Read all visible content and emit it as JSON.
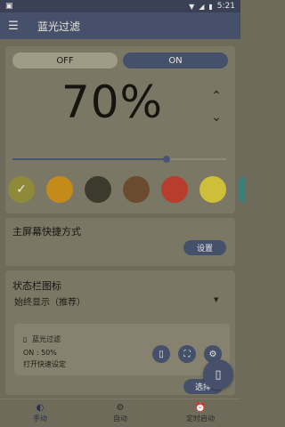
{
  "status_bar": {
    "time": "5:21",
    "icons": [
      "app-icon",
      "wifi-icon",
      "signal-icon",
      "battery-icon"
    ]
  },
  "app_bar": {
    "title": "蓝光过滤",
    "menu_icon": "menu-icon"
  },
  "filter": {
    "off_label": "OFF",
    "on_label": "ON",
    "percent_text": "70%",
    "slider_fraction": 0.72
  },
  "swatches": {
    "colors": [
      "#8f8a3a",
      "#c58b1a",
      "#3b3a2c",
      "#6b4b2e",
      "#b83d2d",
      "#cdbf3a",
      "#3e7e78"
    ],
    "selected_index": 0,
    "check_glyph": "✓"
  },
  "shortcut": {
    "title": "主屏幕快捷方式",
    "settings_label": "设置"
  },
  "status_icon": {
    "title": "状态栏图标",
    "selected_option": "始终显示（推荐）",
    "notification": {
      "title": "蓝光过滤",
      "line1": "ON : 50%",
      "line2": "打开快速设定"
    },
    "select_label": "选择"
  },
  "bottom_nav": {
    "items": [
      {
        "label": "手动",
        "icon": "half-circle-icon"
      },
      {
        "label": "自动",
        "icon": "gear-icon"
      },
      {
        "label": "定时启动",
        "icon": "alarm-clock-icon"
      }
    ],
    "active_index": 0
  },
  "colors": {
    "accent": "#45506b",
    "overlay_tint": "#7b7765"
  }
}
